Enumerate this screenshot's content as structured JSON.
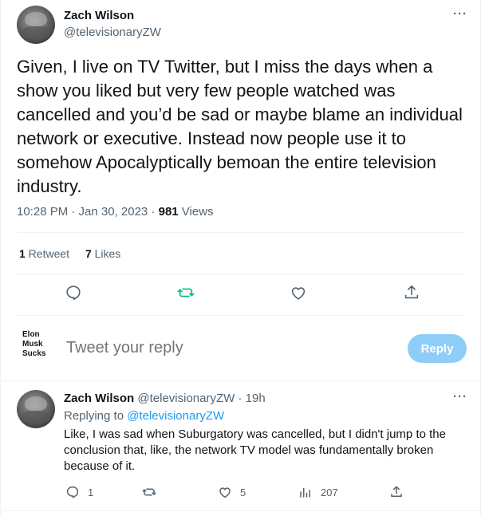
{
  "main_tweet": {
    "author_name": "Zach Wilson",
    "author_handle": "@televisionaryZW",
    "more_label": "···",
    "text": "Given, I live on TV Twitter, but I miss the days when a show you liked but very few people watched was cancelled and you’d be sad or maybe blame an individual network or executive. Instead now people use it to somehow Apocalyptically bemoan the entire television industry.",
    "timestamp": "10:28 PM · Jan 30, 2023 · ",
    "views_count": "981",
    "views_label": " Views",
    "retweets_count": "1",
    "retweets_label": " Retweet",
    "likes_count": "7",
    "likes_label": " Likes"
  },
  "reply_box": {
    "logo_lines": [
      "Elon",
      "Musk",
      "Sucks"
    ],
    "placeholder": "Tweet your reply",
    "button_label": "Reply"
  },
  "reply_tweet": {
    "author_name": "Zach Wilson",
    "author_handle": " @televisionaryZW · 19h",
    "more_label": "···",
    "replying_prefix": "Replying to ",
    "replying_to": "@televisionaryZW",
    "text": "Like, I was sad when Suburgatory was cancelled, but I didn't jump to the conclusion that, like, the network TV model was fundamentally broken because of it.",
    "reply_count": "1",
    "retweet_count": "",
    "like_count": "5",
    "views_count": "207"
  },
  "colors": {
    "accent": "#1d9bf0",
    "retweet_green": "#00ba7c",
    "secondary_text": "#536471",
    "reply_button_disabled": "#8ecdf8"
  },
  "icons": [
    "comment-icon",
    "retweet-icon",
    "like-icon",
    "share-icon",
    "views-icon",
    "more-icon"
  ]
}
